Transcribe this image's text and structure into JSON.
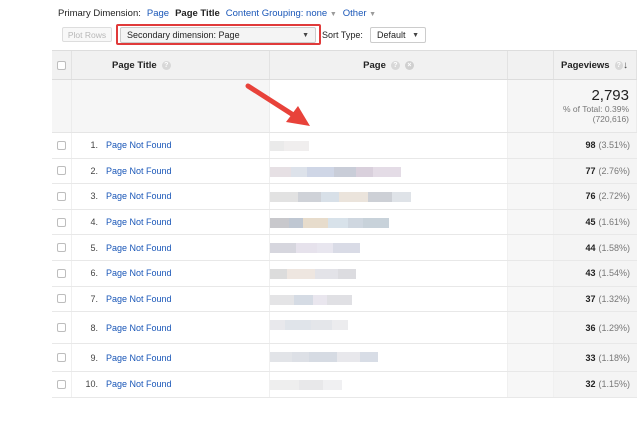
{
  "dimensions": {
    "label": "Primary Dimension:",
    "page": "Page",
    "page_title": "Page Title",
    "content_grouping": "Content Grouping: none",
    "other": "Other"
  },
  "toolbar": {
    "plot_rows": "Plot Rows",
    "secondary_dimension": "Secondary dimension: Page",
    "sort_type_label": "Sort Type:",
    "sort_type_value": "Default"
  },
  "table": {
    "headers": {
      "page_title": "Page Title",
      "page": "Page",
      "pageviews": "Pageviews"
    },
    "totals": {
      "value": "2,793",
      "pct_label": "% of Total: 0.39%",
      "total": "(720,616)"
    },
    "rows": [
      {
        "index": "1.",
        "title": "Page Not Found",
        "pageviews": "98",
        "pct": "(3.51%)"
      },
      {
        "index": "2.",
        "title": "Page Not Found",
        "pageviews": "77",
        "pct": "(2.76%)"
      },
      {
        "index": "3.",
        "title": "Page Not Found",
        "pageviews": "76",
        "pct": "(2.72%)"
      },
      {
        "index": "4.",
        "title": "Page Not Found",
        "pageviews": "45",
        "pct": "(1.61%)"
      },
      {
        "index": "5.",
        "title": "Page Not Found",
        "pageviews": "44",
        "pct": "(1.58%)"
      },
      {
        "index": "6.",
        "title": "Page Not Found",
        "pageviews": "43",
        "pct": "(1.54%)"
      },
      {
        "index": "7.",
        "title": "Page Not Found",
        "pageviews": "37",
        "pct": "(1.32%)"
      },
      {
        "index": "8.",
        "title": "Page Not Found",
        "pageviews": "36",
        "pct": "(1.29%)"
      },
      {
        "index": "9.",
        "title": "Page Not Found",
        "pageviews": "33",
        "pct": "(1.18%)"
      },
      {
        "index": "10.",
        "title": "Page Not Found",
        "pageviews": "32",
        "pct": "(1.15%)"
      }
    ]
  },
  "colors": {
    "link": "#1a57b8",
    "highlight": "#e03a3a",
    "arrow": "#e8423a"
  }
}
